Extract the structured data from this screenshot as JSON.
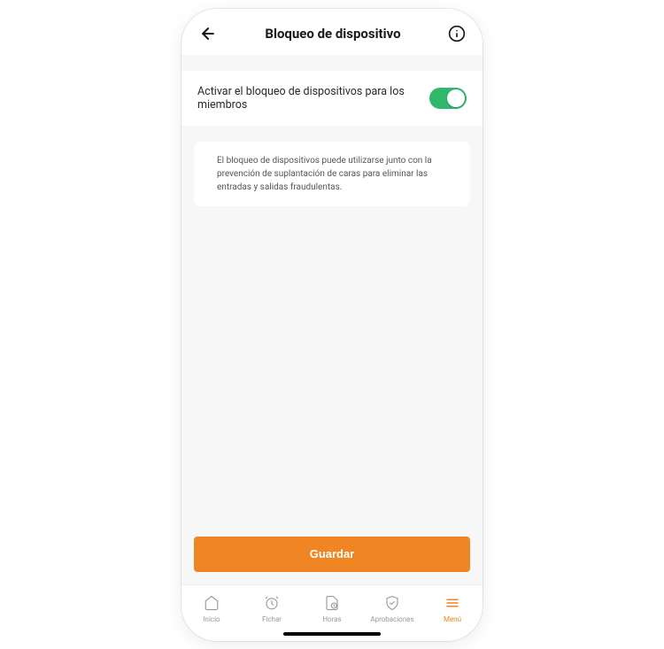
{
  "header": {
    "title": "Bloqueo de dispositivo"
  },
  "toggle_section": {
    "label": "Activar el bloqueo de dispositivos para los miembros",
    "enabled": true
  },
  "info_card": {
    "text": "El bloqueo de dispositivos puede utilizarse junto con la prevención de suplantación de caras para eliminar las entradas y salidas fraudulentas."
  },
  "save_button": {
    "label": "Guardar"
  },
  "bottom_nav": {
    "items": [
      {
        "label": "Inicio",
        "icon": "home-icon",
        "active": false
      },
      {
        "label": "Fichar",
        "icon": "clock-icon",
        "active": false
      },
      {
        "label": "Horas",
        "icon": "timesheet-icon",
        "active": false
      },
      {
        "label": "Aprobaciones",
        "icon": "shield-icon",
        "active": false
      },
      {
        "label": "Menú",
        "icon": "menu-icon",
        "active": true
      }
    ]
  },
  "colors": {
    "accent": "#f08523",
    "toggle_on": "#2fb76b"
  }
}
